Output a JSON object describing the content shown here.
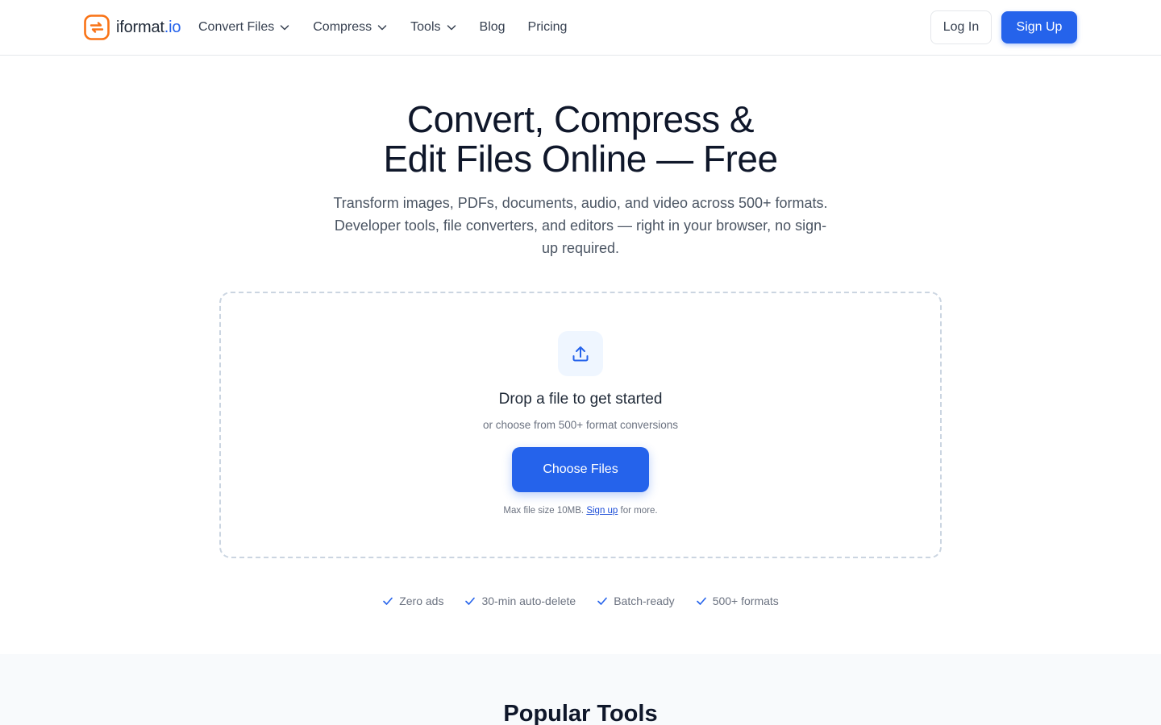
{
  "brand": {
    "name": "iformat",
    "tld": ".io",
    "logo_color": "#f97316",
    "accent_color": "#2563eb"
  },
  "nav": {
    "items": [
      {
        "label": "Convert Files",
        "has_dropdown": true
      },
      {
        "label": "Compress",
        "has_dropdown": true
      },
      {
        "label": "Tools",
        "has_dropdown": true
      },
      {
        "label": "Blog",
        "has_dropdown": false
      },
      {
        "label": "Pricing",
        "has_dropdown": false
      }
    ],
    "login_label": "Log In",
    "signup_label": "Sign Up"
  },
  "hero": {
    "title_line1": "Convert, Compress &",
    "title_line2": "Edit Files Online — Free",
    "subtitle": "Transform images, PDFs, documents, audio, and video across 500+ formats. Developer tools, file converters, and editors — right in your browser, no sign-up required."
  },
  "dropzone": {
    "icon": "upload-icon",
    "title": "Drop a file to get started",
    "subtitle": "or choose from 500+ format conversions",
    "button_label": "Choose Files",
    "note_prefix": "Max file size 10MB.",
    "note_link": "Sign up",
    "note_suffix": "for more."
  },
  "features": [
    {
      "icon": "check-icon",
      "label": "Zero ads"
    },
    {
      "icon": "check-icon",
      "label": "30-min auto-delete"
    },
    {
      "icon": "check-icon",
      "label": "Batch-ready"
    },
    {
      "icon": "check-icon",
      "label": "500+ formats"
    }
  ],
  "popular": {
    "title": "Popular Tools"
  }
}
